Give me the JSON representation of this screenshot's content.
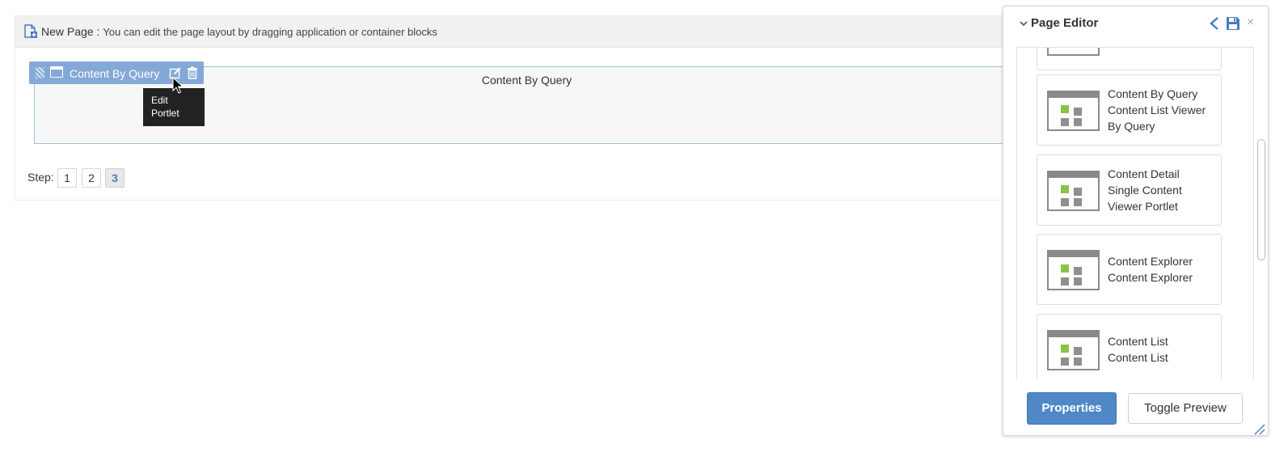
{
  "page": {
    "header_title": "New Page",
    "header_separator": " : ",
    "header_description": "You can edit the page layout by dragging application or container blocks"
  },
  "portlet": {
    "toolbar_label": "Content By Query",
    "title": "Content By Query",
    "tooltip_line1": "Edit",
    "tooltip_line2": "Portlet"
  },
  "steps": {
    "label": "Step:",
    "items": [
      "1",
      "2",
      "3"
    ],
    "active": "3"
  },
  "editor": {
    "title": "Page Editor",
    "close_glyph": "×",
    "applications": [
      {
        "name": "Content By Query",
        "description_lines": [
          "Content List Viewer",
          "By Query"
        ]
      },
      {
        "name": "Content Detail",
        "description_lines": [
          "Single Content",
          "Viewer Portlet"
        ]
      },
      {
        "name": "Content Explorer",
        "description_lines": [
          "Content Explorer"
        ]
      },
      {
        "name": "Content List",
        "description_lines": [
          "Content List"
        ]
      }
    ],
    "properties_label": "Properties",
    "toggle_preview_label": "Toggle Preview"
  },
  "colors": {
    "accent": "#4e88c7",
    "toolbar_blue": "#84a9d6",
    "icon_green": "#8bc34a"
  }
}
